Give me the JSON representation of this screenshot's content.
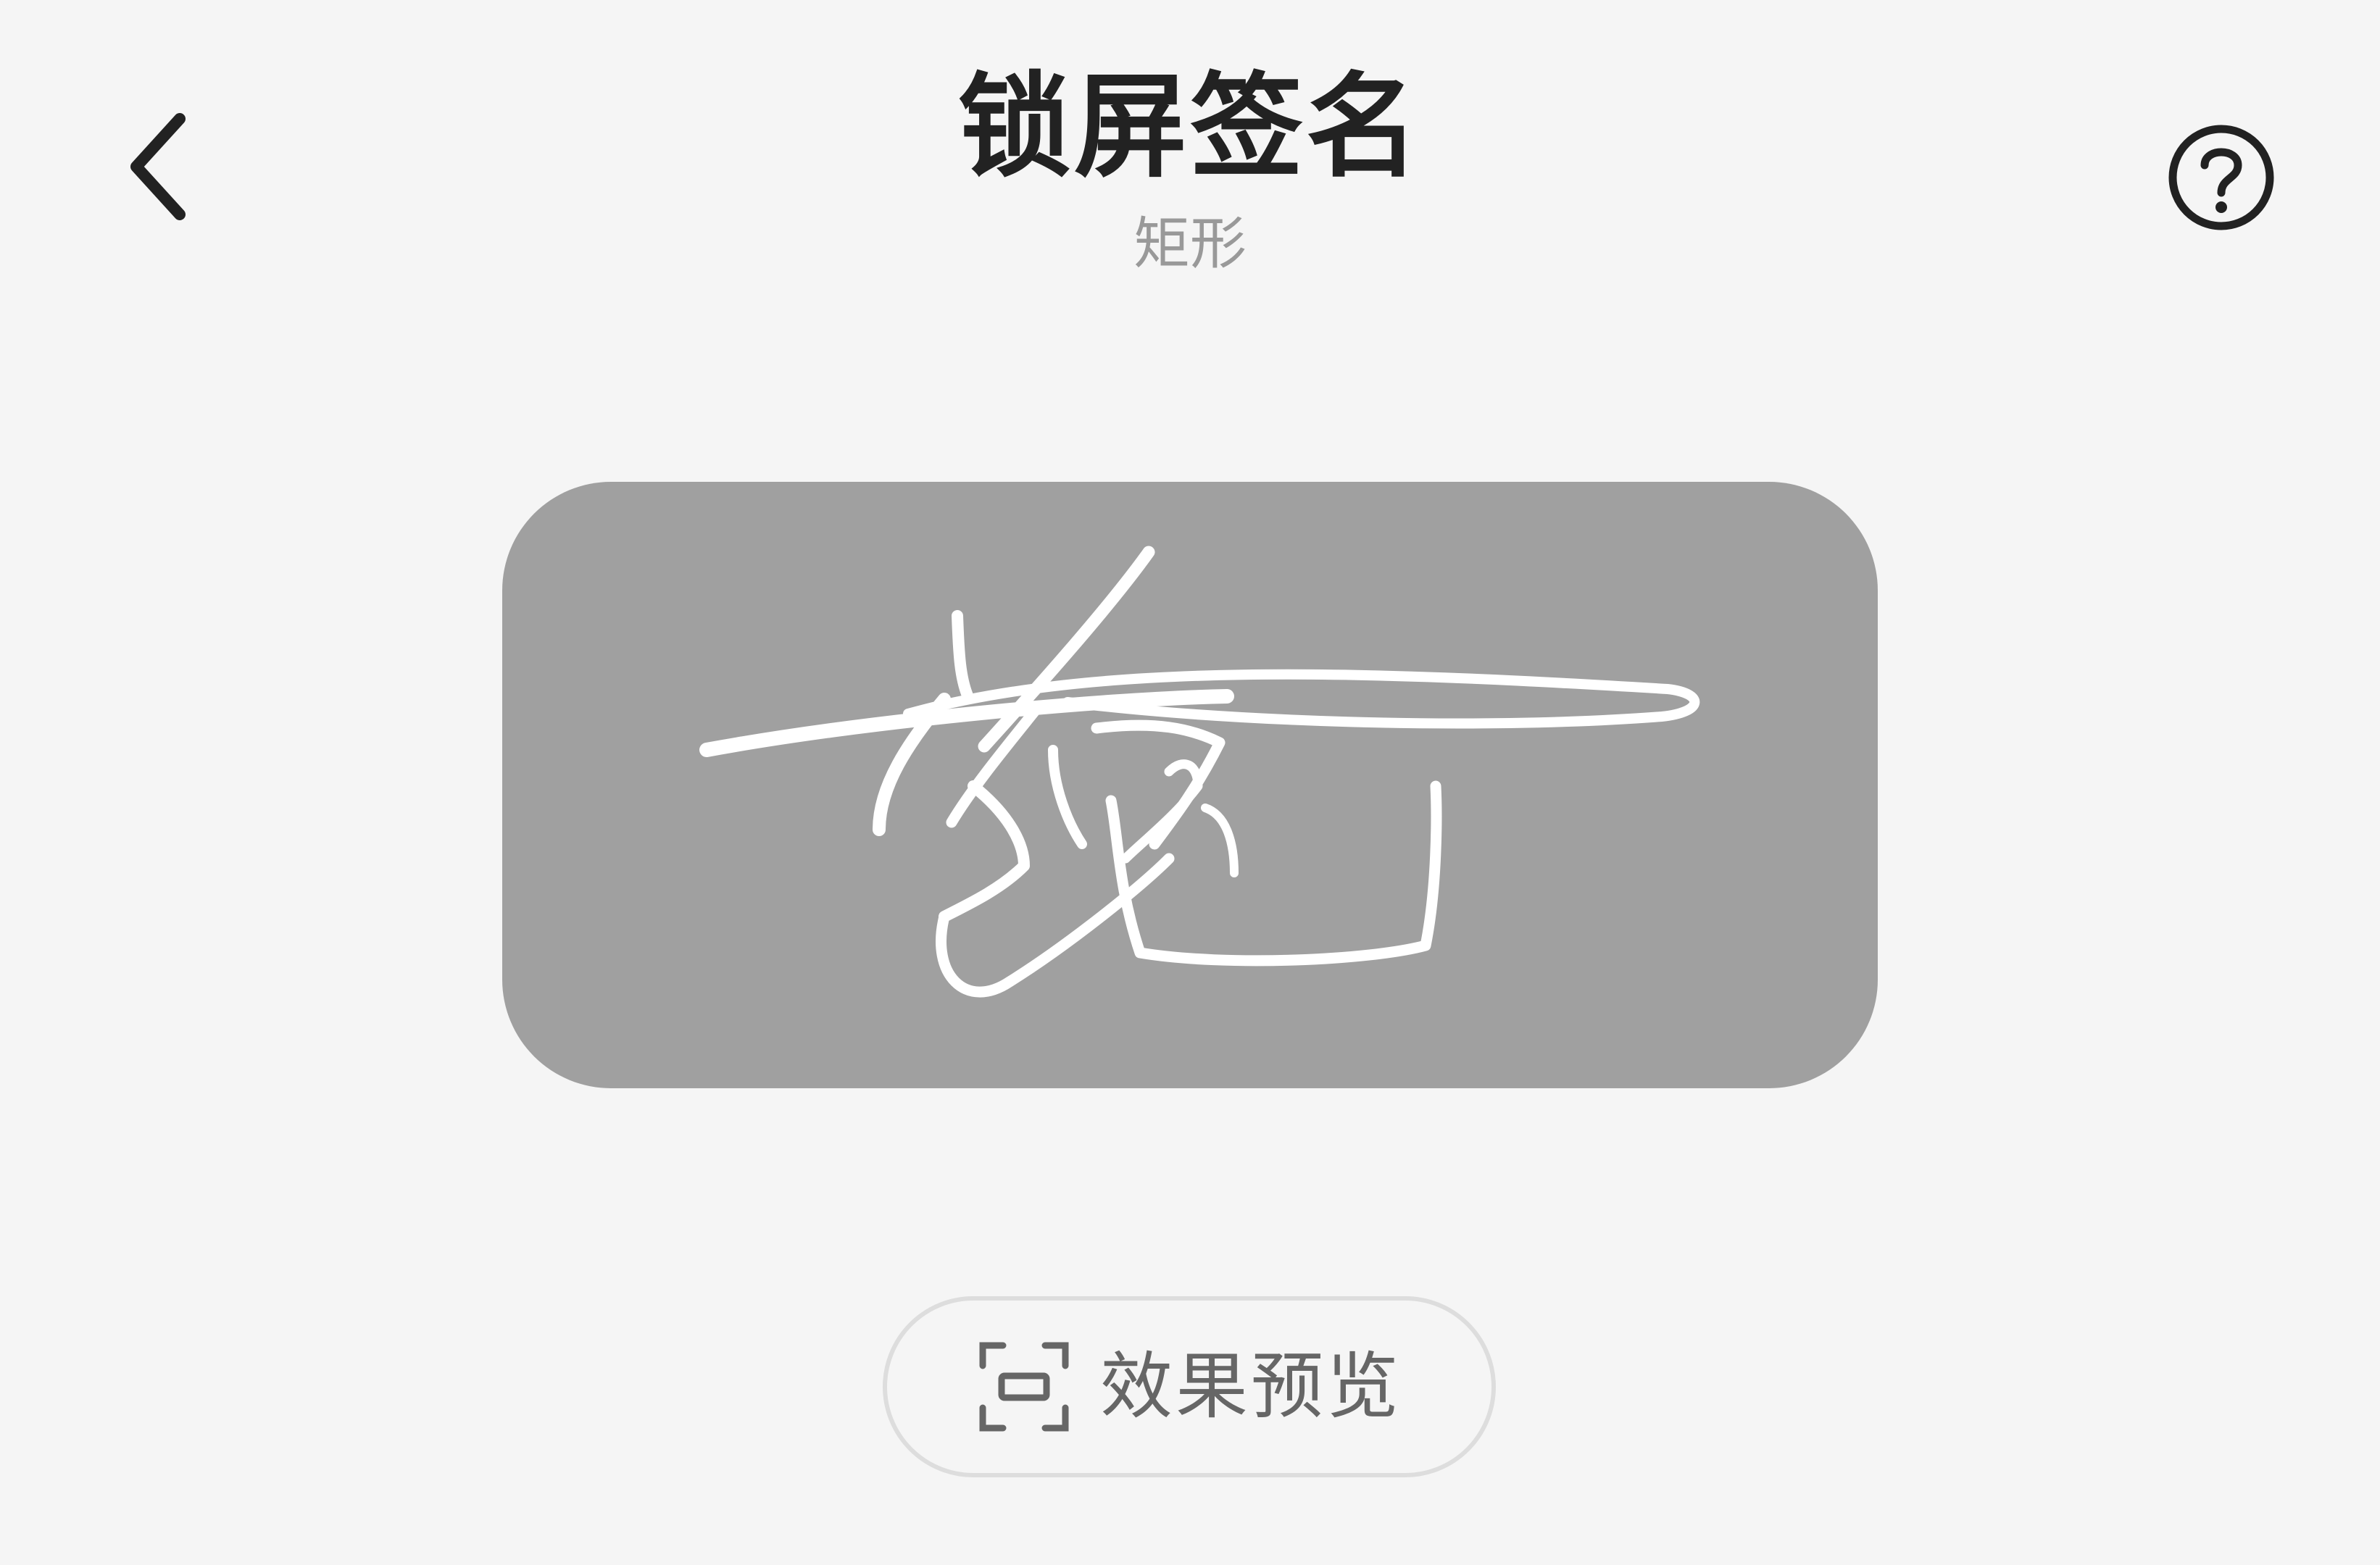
{
  "header": {
    "title": "锁屏签名",
    "subtitle": "矩形",
    "back_icon": "chevron-left-icon",
    "help_icon": "question-circle-icon"
  },
  "signature": {
    "text": "签名"
  },
  "preview_button": {
    "label": "效果预览",
    "icon": "scan-frame-icon"
  },
  "colors": {
    "background": "#f5f5f5",
    "text_primary": "#222222",
    "text_secondary": "#999999",
    "card": "#a0a0a0",
    "stroke": "#ffffff",
    "button_border": "#dddddd",
    "button_text": "#666666"
  }
}
